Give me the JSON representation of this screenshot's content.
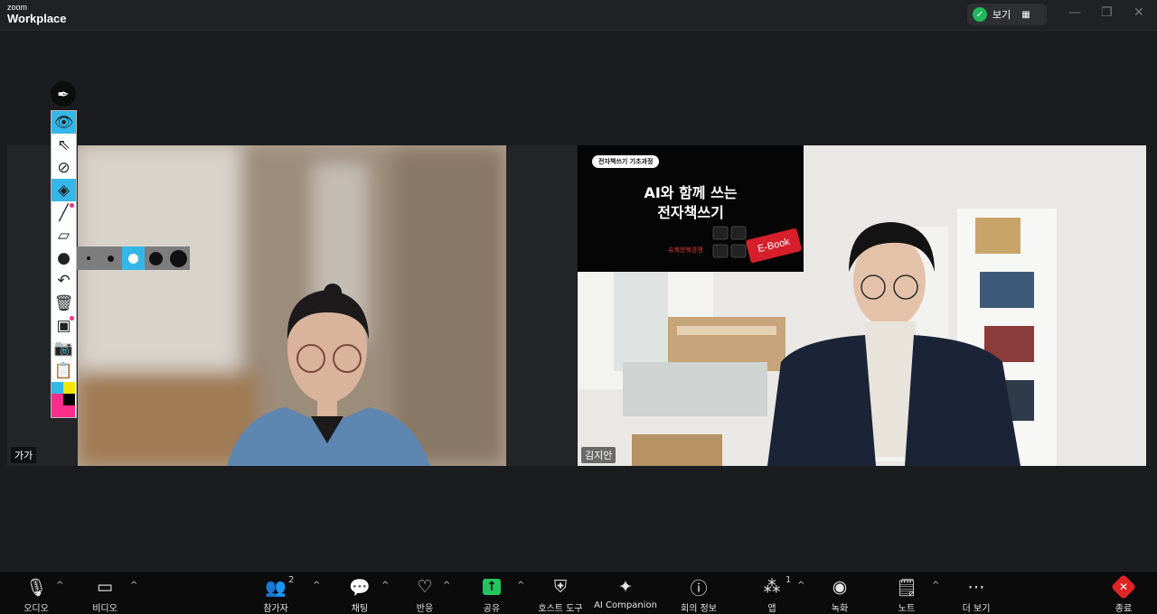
{
  "app": {
    "brand_small": "zoom",
    "brand_large": "Workplace"
  },
  "header": {
    "view_label": "보기"
  },
  "participants": [
    {
      "name": "가가"
    },
    {
      "name": "김지안"
    }
  ],
  "shared_banner": {
    "pill": "전자책쓰기 기초과정",
    "title_line1": "AI와 함께 쓰는",
    "title_line2": "전자책쓰기",
    "author": "유쾌한북경쟁",
    "key_text": "E-Book"
  },
  "annotation_palette": [
    "#35b6e8",
    "#f5e600",
    "#ff2d8a",
    "#000000",
    "#ff2d8a",
    "#ff2d8a"
  ],
  "bottom_bar": {
    "audio": "오디오",
    "video": "비디오",
    "participants": "참가자",
    "participants_count": "2",
    "chat": "채팅",
    "reactions": "반응",
    "share": "공유",
    "host_tools": "호스트 도구",
    "ai_companion": "AI Companion",
    "meeting_info": "회의 정보",
    "apps": "앱",
    "apps_count": "1",
    "record": "녹화",
    "notes": "노트",
    "more": "더 보기",
    "end": "종료"
  }
}
